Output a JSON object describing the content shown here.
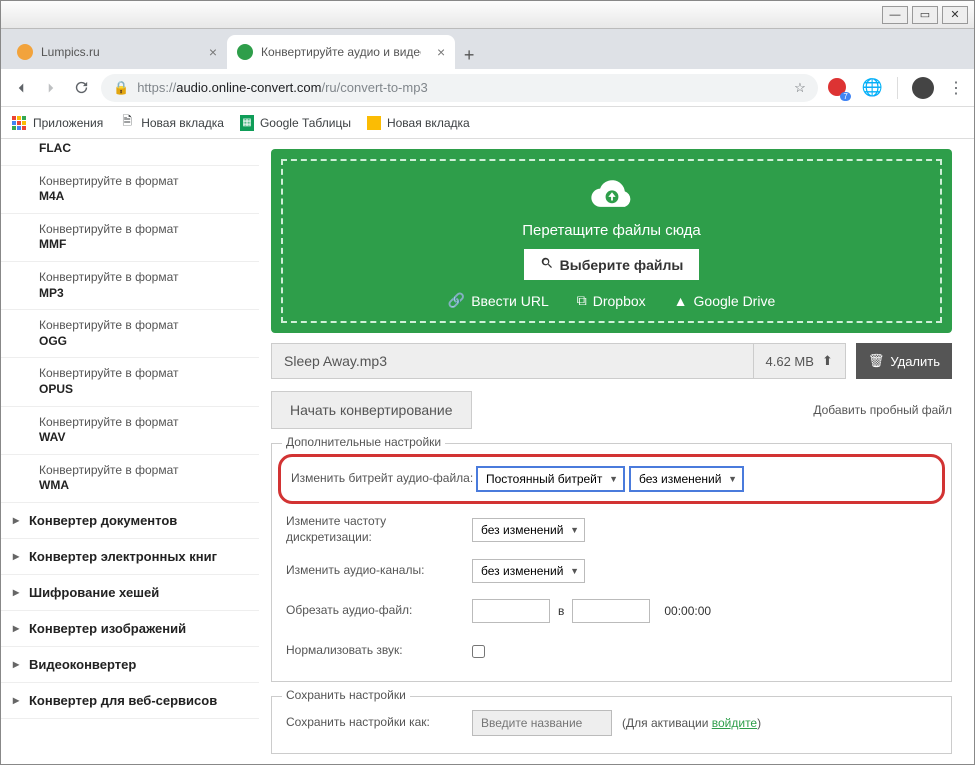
{
  "tabs": [
    {
      "title": "Lumpics.ru",
      "active": false,
      "favicon": "#f2a33c"
    },
    {
      "title": "Конвертируйте аудио и видео в",
      "active": true,
      "favicon": "#2e9e4a"
    }
  ],
  "url": {
    "protocol": "https://",
    "host": "audio.online-convert.com",
    "path": "/ru/convert-to-mp3"
  },
  "bookmarks": [
    {
      "label": "Приложения",
      "icon": "apps"
    },
    {
      "label": "Новая вкладка",
      "icon": "page"
    },
    {
      "label": "Google Таблицы",
      "icon": "sheets"
    },
    {
      "label": "Новая вкладка",
      "icon": "gitem"
    }
  ],
  "ext_badge": "7",
  "sidebar": {
    "prefix": "Конвертируйте в формат",
    "items": [
      "FLAC",
      "M4A",
      "MMF",
      "MP3",
      "OGG",
      "OPUS",
      "WAV",
      "WMA"
    ],
    "categories": [
      "Конвертер документов",
      "Конвертер электронных книг",
      "Шифрование хешей",
      "Конвертер изображений",
      "Видеоконвертер",
      "Конвертер для веб-сервисов"
    ]
  },
  "dropzone": {
    "text": "Перетащите файлы сюда",
    "choose": "Выберите файлы",
    "links": {
      "url": "Ввести URL",
      "dropbox": "Dropbox",
      "gdrive": "Google Drive"
    }
  },
  "file": {
    "name": "Sleep Away.mp3",
    "size": "4.62 MB"
  },
  "actions": {
    "delete": "Удалить",
    "start": "Начать конвертирование",
    "add_test": "Добавить пробный файл"
  },
  "settings": {
    "legend": "Дополнительные настройки",
    "bitrate_label": "Изменить битрейт аудио-файла:",
    "bitrate_mode": "Постоянный битрейт",
    "bitrate_value": "без изменений",
    "samplerate_label": "Измените частоту дискретизации:",
    "samplerate_value": "без изменений",
    "channels_label": "Изменить аудио-каналы:",
    "channels_value": "без изменений",
    "trim_label": "Обрезать аудио-файл:",
    "trim_sep": "в",
    "trim_end": "00:00:00",
    "normalize_label": "Нормализовать звук:"
  },
  "save": {
    "legend": "Сохранить настройки",
    "label": "Сохранить настройки как:",
    "placeholder": "Введите название",
    "note_prefix": "(Для активации ",
    "note_link": "войдите",
    "note_suffix": ")"
  }
}
